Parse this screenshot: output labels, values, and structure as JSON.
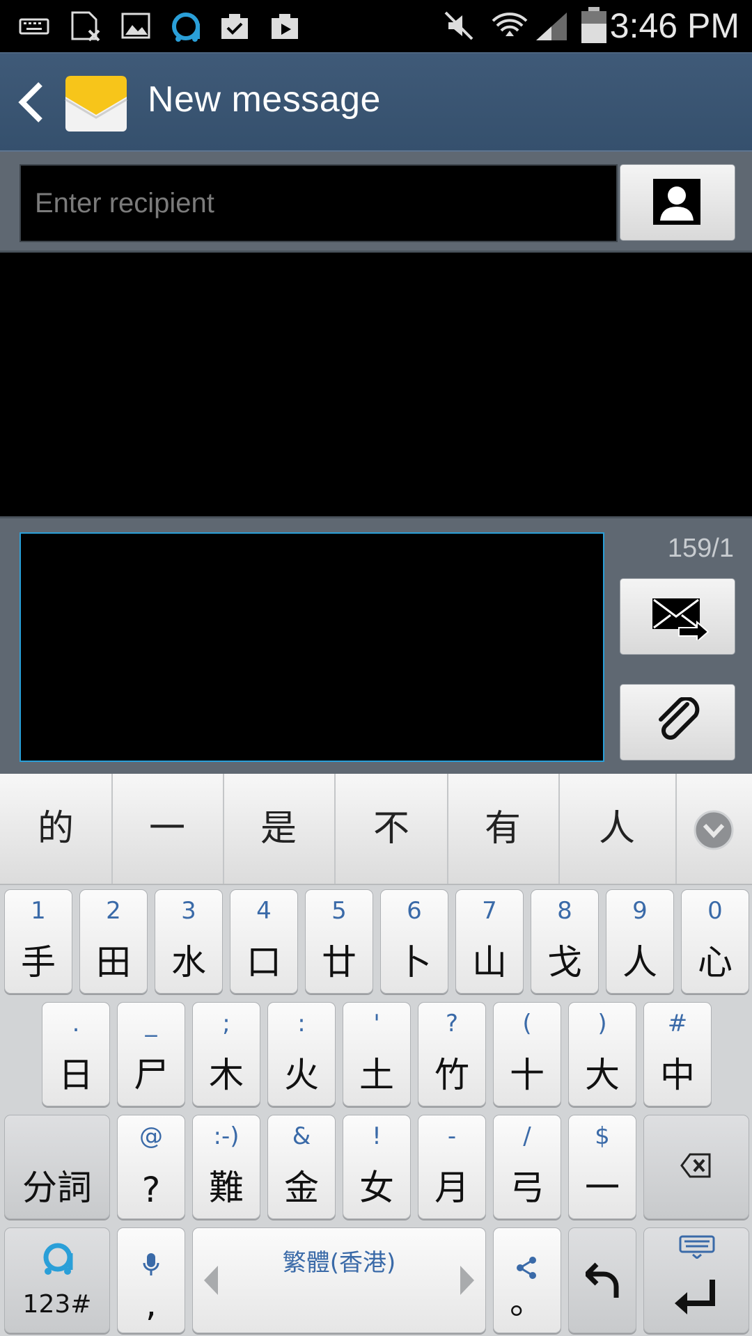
{
  "status_bar": {
    "time": "3:46 PM",
    "icons": [
      "keyboard-icon",
      "sim-error-icon",
      "gallery-icon",
      "app-a-icon",
      "task-icon",
      "play-store-icon",
      "mute-icon",
      "wifi-icon",
      "signal-icon",
      "battery-icon"
    ]
  },
  "action_bar": {
    "title": "New message",
    "back_icon": "back-chevron-icon",
    "app_icon": "envelope-icon"
  },
  "recipient": {
    "placeholder": "Enter recipient",
    "contacts_icon": "contact-icon"
  },
  "compose": {
    "counter": "159/1",
    "send_icon": "send-message-icon",
    "attach_icon": "paperclip-icon"
  },
  "keyboard": {
    "suggestions": [
      "的",
      "一",
      "是",
      "不",
      "有",
      "人"
    ],
    "row1": [
      {
        "sub": "1",
        "main": "手"
      },
      {
        "sub": "2",
        "main": "田"
      },
      {
        "sub": "3",
        "main": "水"
      },
      {
        "sub": "4",
        "main": "口"
      },
      {
        "sub": "5",
        "main": "廿"
      },
      {
        "sub": "6",
        "main": "卜"
      },
      {
        "sub": "7",
        "main": "山"
      },
      {
        "sub": "8",
        "main": "戈"
      },
      {
        "sub": "9",
        "main": "人"
      },
      {
        "sub": "0",
        "main": "心"
      }
    ],
    "row2": [
      {
        "sub": ".",
        "main": "日"
      },
      {
        "sub": "_",
        "main": "尸"
      },
      {
        "sub": ";",
        "main": "木"
      },
      {
        "sub": ":",
        "main": "火"
      },
      {
        "sub": "'",
        "main": "土"
      },
      {
        "sub": "?",
        "main": "竹"
      },
      {
        "sub": "(",
        "main": "十"
      },
      {
        "sub": ")",
        "main": "大"
      },
      {
        "sub": "#",
        "main": "中"
      }
    ],
    "row3_left": "分詞",
    "row3": [
      {
        "sub": "@",
        "main": "?"
      },
      {
        "sub": ":-)",
        "main": "難"
      },
      {
        "sub": "&",
        "main": "金"
      },
      {
        "sub": "!",
        "main": "女"
      },
      {
        "sub": "-",
        "main": "月"
      },
      {
        "sub": "/",
        "main": "弓"
      },
      {
        "sub": "$",
        "main": "一"
      }
    ],
    "mode_label": "123#",
    "voice_sub": ",",
    "space_label": "繁體(香港)",
    "share_sub": "。",
    "colors": {
      "accent": "#3a6aa8",
      "key_face": "#f2f2f2",
      "board": "#d2d4d6"
    }
  }
}
